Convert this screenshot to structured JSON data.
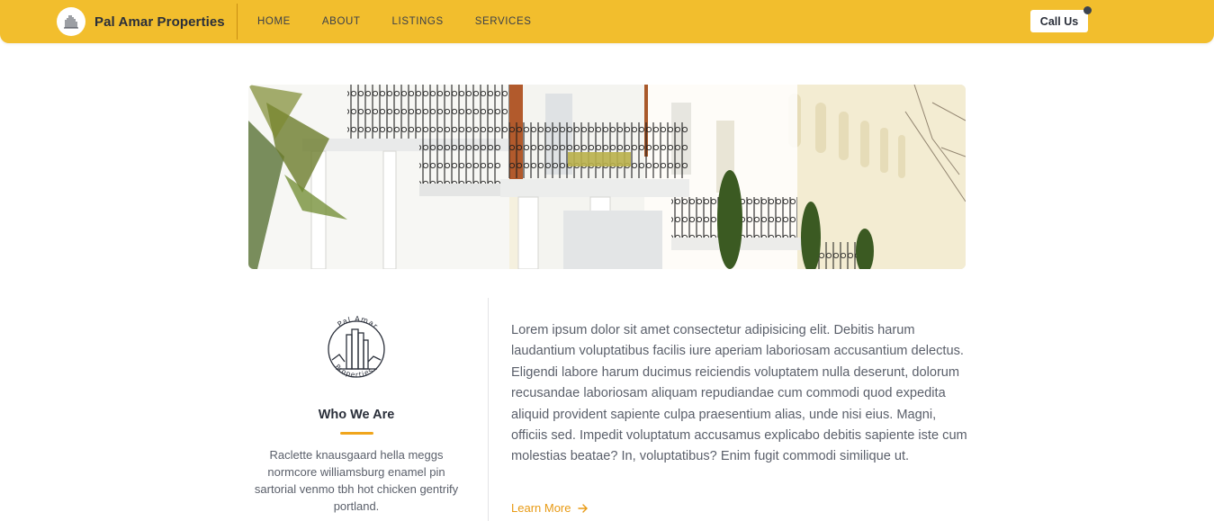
{
  "navbar": {
    "brand_name": "Pal Amar Properties",
    "links": [
      "HOME",
      "ABOUT",
      "LISTINGS",
      "SERVICES"
    ],
    "cta_label": "Call Us",
    "accent_color": "#f2be2d"
  },
  "hero": {
    "image_subject": "row of white terraced houses with black wrought-iron balconies"
  },
  "about": {
    "logo_top_text": "Pal Amar",
    "logo_bottom_text": "Properties",
    "heading": "Who We Are",
    "blurb": "Raclette knausgaard hella meggs normcore williamsburg enamel pin sartorial venmo tbh hot chicken gentrify portland.",
    "body": "Lorem ipsum dolor sit amet consectetur adipisicing elit. Debitis harum laudantium voluptatibus facilis iure aperiam laboriosam accusantium delectus. Eligendi labore harum ducimus reiciendis voluptatem nulla deserunt, dolorum recusandae laboriosam aliquam repudiandae cum commodi quod expedita aliquid provident sapiente culpa praesentium alias, unde nisi eius. Magni, officiis sed. Impedit voluptatum accusamus explicabo debitis sapiente iste cum molestias beatae? In, voluptatibus? Enim fugit commodi similique ut.",
    "link_label": "Learn More",
    "link_icon": "arrow-right-icon",
    "accent_color": "#f0a51c"
  }
}
